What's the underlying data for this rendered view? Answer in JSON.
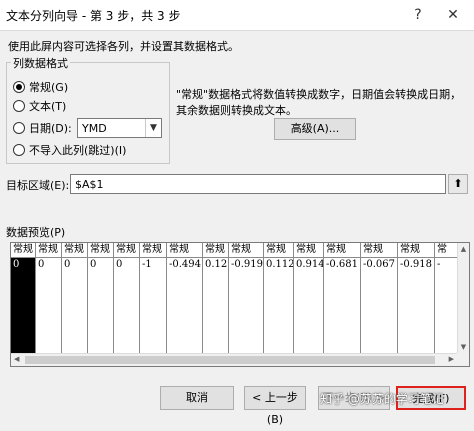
{
  "window": {
    "title": "文本分列向导 - 第 3 步，共 3 步",
    "help_label": "?",
    "close_label": "✕"
  },
  "instruction": "使用此屏内容可选择各列，并设置其数据格式。",
  "column_format": {
    "legend": "列数据格式",
    "options": [
      {
        "label": "常规(G)",
        "checked": true
      },
      {
        "label": "文本(T)",
        "checked": false
      },
      {
        "label": "日期(D):",
        "checked": false
      },
      {
        "label": "不导入此列(跳过)(I)",
        "checked": false
      }
    ],
    "date_format_value": "YMD"
  },
  "description": "\"常规\"数据格式将数值转换成数字，日期值会转换成日期，其余数据则转换成文本。",
  "advanced_button": "高级(A)...",
  "destination": {
    "label": "目标区域(E):",
    "value": "$A$1"
  },
  "preview": {
    "label": "数据预览(P)",
    "columns": [
      {
        "header": "常规",
        "value": "0",
        "selected": true
      },
      {
        "header": "常规",
        "value": "0"
      },
      {
        "header": "常规",
        "value": "0"
      },
      {
        "header": "常规",
        "value": "0"
      },
      {
        "header": "常规",
        "value": "0"
      },
      {
        "header": "常规",
        "value": "-1"
      },
      {
        "header": "常规",
        "value": "-0.494"
      },
      {
        "header": "常规",
        "value": "0.12"
      },
      {
        "header": "常规",
        "value": "-0.919"
      },
      {
        "header": "常规",
        "value": "0.112"
      },
      {
        "header": "常规",
        "value": "0.914"
      },
      {
        "header": "常规",
        "value": "-0.681"
      },
      {
        "header": "常规",
        "value": "-0.067"
      },
      {
        "header": "常规",
        "value": "-0.918"
      },
      {
        "header": "常",
        "value": "-"
      }
    ]
  },
  "buttons": {
    "cancel": "取消",
    "back": "< 上一步(B)",
    "next": "下一步(N) >",
    "finish": "完成(F)"
  },
  "watermark": "知乎 @苏苏的学习笔记",
  "colors": {
    "highlight_border": "#e0201b",
    "selected_column": "#000000"
  }
}
